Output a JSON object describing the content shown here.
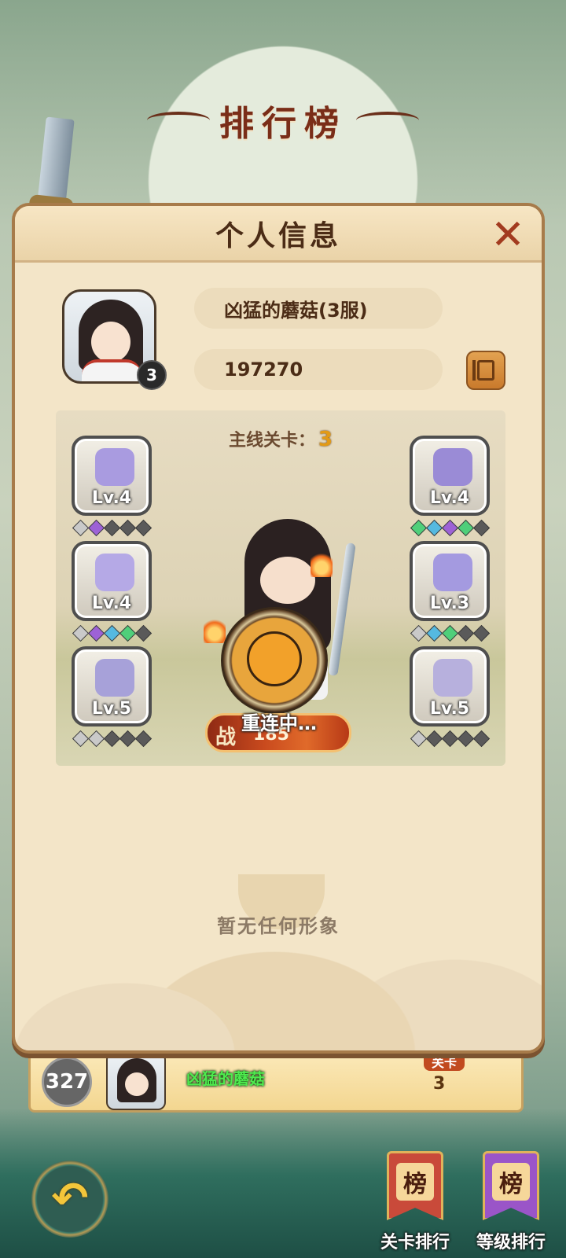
{
  "leaderboard": {
    "title": "排行榜"
  },
  "profile_panel": {
    "title": "个人信息",
    "close_icon": "close-x-icon",
    "player": {
      "name": "凶猛的蘑菇(3服)",
      "power": "197270",
      "level": "3"
    },
    "main_stage": {
      "label": "主线关卡：",
      "value": "3"
    },
    "equipment_left": [
      {
        "slot": "helmet",
        "icon": "hat-icon",
        "level": "Lv.4",
        "color": "#a99be0",
        "gems": [
          "#c9c9c9",
          "#9d62d6",
          "#5a5a5a",
          "#5a5a5a",
          "#5a5a5a"
        ]
      },
      {
        "slot": "armor",
        "icon": "robe-icon",
        "level": "Lv.4",
        "color": "#b5a9e6",
        "gems": [
          "#c9c9c9",
          "#9d62d6",
          "#55b9e0",
          "#4fcf7a",
          "#5a5a5a"
        ]
      },
      {
        "slot": "boots",
        "icon": "boots-icon",
        "level": "Lv.5",
        "color": "#a7a1d9",
        "gems": [
          "#c9c9c9",
          "#c9c9c9",
          "#5a5a5a",
          "#5a5a5a",
          "#5a5a5a"
        ]
      }
    ],
    "equipment_right": [
      {
        "slot": "weapon",
        "icon": "sword-icon",
        "level": "Lv.4",
        "color": "#9a8bd6",
        "gems": [
          "#4fcf7a",
          "#55b9e0",
          "#9d62d6",
          "#4fcf7a",
          "#5a5a5a"
        ]
      },
      {
        "slot": "ring",
        "icon": "ring-icon",
        "level": "Lv.3",
        "color": "#a49ae0",
        "gems": [
          "#c9c9c9",
          "#55b9e0",
          "#4fcf7a",
          "#5a5a5a",
          "#5a5a5a"
        ]
      },
      {
        "slot": "necklace",
        "icon": "necklace-icon",
        "level": "Lv.5",
        "color": "#b7b0dd",
        "gems": [
          "#c9c9c9",
          "#5a5a5a",
          "#5a5a5a",
          "#5a5a5a",
          "#5a5a5a"
        ]
      }
    ],
    "battle": {
      "icon_text": "战",
      "power": "185",
      "status": "重连中…"
    },
    "empty_state": {
      "text": "暂无任何形象"
    }
  },
  "rank_entry": {
    "rank": "327",
    "name": "凶猛的蘑菇",
    "stage_label": "关卡",
    "stage_value": "3"
  },
  "bottom_bar": {
    "back_icon": "back-arrow-icon",
    "stage_rank": {
      "flag_text": "榜",
      "label": "关卡排行",
      "color": "#c94a3a"
    },
    "level_rank": {
      "flag_text": "榜",
      "label": "等级排行",
      "color": "#9a55c8"
    }
  }
}
